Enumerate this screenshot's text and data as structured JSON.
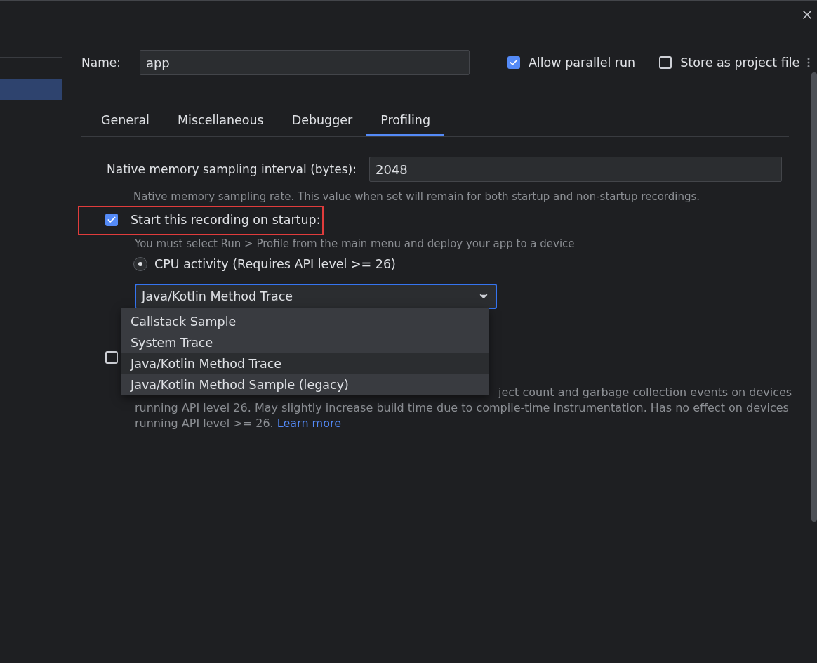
{
  "name_field": {
    "label": "Name:",
    "value": "app"
  },
  "options": [
    {
      "label": "Allow parallel run",
      "checked": true
    },
    {
      "label": "Store as project file",
      "checked": false
    }
  ],
  "tabs": [
    {
      "label": "General",
      "selected": false
    },
    {
      "label": "Miscellaneous",
      "selected": false
    },
    {
      "label": "Debugger",
      "selected": false
    },
    {
      "label": "Profiling",
      "selected": true
    }
  ],
  "interval": {
    "label": "Native memory sampling interval (bytes):",
    "value": "2048",
    "hint": "Native memory sampling rate. This value when set will remain for both startup and non-startup recordings."
  },
  "startup": {
    "label": "Start this recording on startup:",
    "checked": true,
    "highlighted": true,
    "hint": "You must select Run > Profile from the main menu and deploy your app to a device"
  },
  "cpu_radio": {
    "label": "CPU activity (Requires API level >= 26)",
    "selected": true
  },
  "dropdown": {
    "value": "Java/Kotlin Method Trace",
    "expanded": true,
    "options": [
      {
        "label": "Callstack Sample",
        "selected": false
      },
      {
        "label": "System Trace",
        "selected": false
      },
      {
        "label": "Java/Kotlin Method Trace",
        "selected": true
      },
      {
        "label": "Java/Kotlin Method Sample (legacy)",
        "selected": false
      }
    ]
  },
  "allocation": {
    "checked": false,
    "lines": [
      "ject count and garbage collection events on devices",
      "running API level 26. May slightly increase build time due to compile-time instrumentation. Has no effect on devices",
      "running API level >= 26."
    ],
    "link": "Learn more"
  }
}
